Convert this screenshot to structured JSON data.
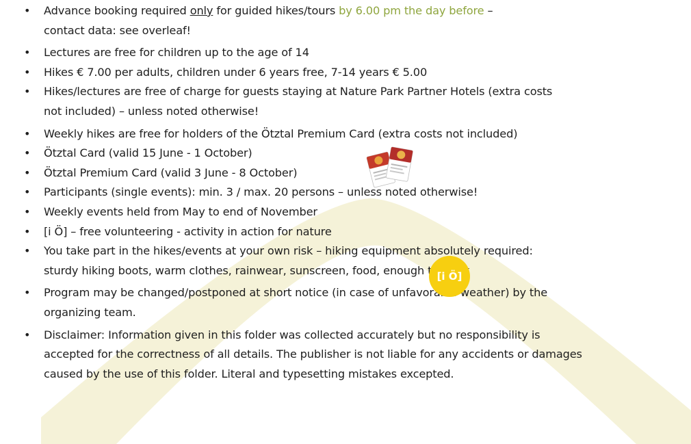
{
  "colors": {
    "highlight_green": "#8fa63f",
    "badge_yellow": "#f7cf10",
    "watermark_tint": "#f5f2d8",
    "text": "#1f1f1f"
  },
  "bullet_glyph": "•",
  "notes": [
    {
      "pre": "Advance booking required ",
      "underlined": "only",
      "mid": " for guided hikes/tours ",
      "highlight": "by 6.00 pm the day before",
      "post": " –",
      "line2": "contact data: see overleaf!"
    },
    {
      "text": "Lectures are free for children up to the age of 14"
    },
    {
      "text": "Hikes € 7.00 per adults, children under 6 years free, 7-14 years € 5.00"
    },
    {
      "line1": "Hikes/lectures are free of charge for guests staying at Nature Park Partner Hotels (extra costs",
      "line2": "not included) – unless noted otherwise!"
    },
    {
      "text": "Weekly hikes are free for holders of the Ötztal Premium Card (extra costs not included)"
    },
    {
      "text": "Ötztal Card (valid 15 June - 1 October)"
    },
    {
      "text": "Ötztal Premium Card (valid 3 June - 8 October)"
    },
    {
      "text": "Participants (single events): min. 3 / max. 20 persons – unless noted otherwise!"
    },
    {
      "text": "Weekly events held from May to end of November"
    },
    {
      "text": "[i Ö]  –  free volunteering - activity in action for nature"
    },
    {
      "line1": "You take part in the hikes/events at your own risk – hiking equipment absolutely required:",
      "line2": "sturdy hiking boots, warm clothes, rainwear, sunscreen, food, enough to drink"
    },
    {
      "line1": "Program may be changed/postponed at short notice (in case of unfavorable weather) by the",
      "line2": "organizing team."
    },
    {
      "line1": "Disclaimer: Information given in this folder was collected accurately but no responsibility is",
      "line2": "accepted for the correctness of all details. The publisher is not liable for any accidents or damages",
      "line3": "caused by the use of this folder. Literal and typesetting mistakes excepted."
    }
  ],
  "badge": {
    "label": "[i Ö]"
  },
  "icons": {
    "cards": "oetztal-cards-icon",
    "badge": "io-volunteer-badge-icon",
    "watermark": "mountain-watermark"
  }
}
